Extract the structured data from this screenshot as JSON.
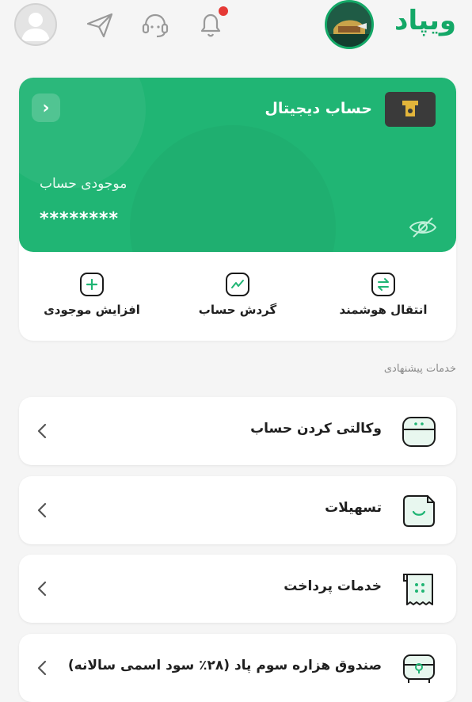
{
  "header": {
    "brand_name": "ویپاد",
    "icons": [
      "profile-icon",
      "send-icon",
      "support-icon",
      "notification-icon"
    ]
  },
  "account_card": {
    "title": "حساب دیجیتال",
    "balance_label": "موجودی حساب",
    "balance_value": "********",
    "colors": {
      "card_bg": "#20b574",
      "brand": "#14a867"
    }
  },
  "quick_actions": [
    {
      "label": "انتقال هوشمند",
      "icon": "transfer-icon"
    },
    {
      "label": "گردش حساب",
      "icon": "chart-icon"
    },
    {
      "label": "افزایش موجودی",
      "icon": "plus-icon"
    }
  ],
  "suggested": {
    "title": "خدمات پیشنهادی",
    "items": [
      {
        "label": "وکالتی کردن حساب",
        "icon": "power-of-attorney-icon"
      },
      {
        "label": "تسهیلات",
        "icon": "loan-icon"
      },
      {
        "label": "خدمات پرداخت",
        "icon": "payment-receipt-icon"
      },
      {
        "label": "صندوق هزاره سوم پاد (۲۸٪ سود اسمی سالانه)",
        "icon": "fund-safe-icon"
      }
    ]
  }
}
